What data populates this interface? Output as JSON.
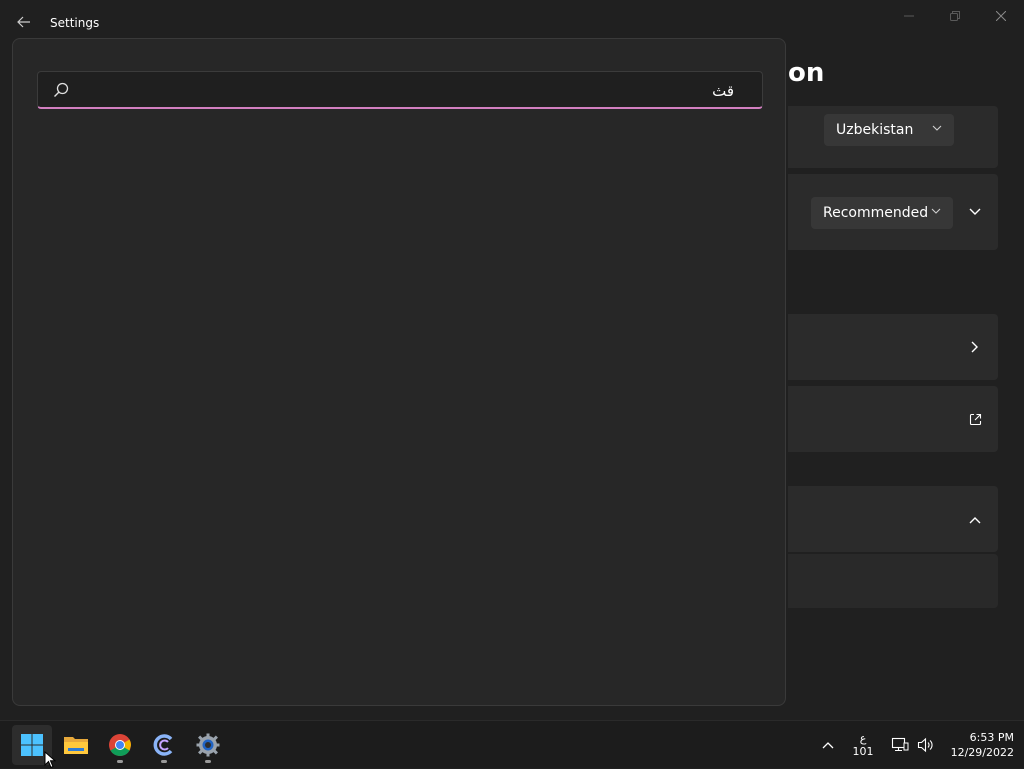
{
  "window": {
    "title": "Settings",
    "page_title_partial": "on"
  },
  "right_panel": {
    "country_dropdown": {
      "value": "Uzbekistan"
    },
    "format_dropdown": {
      "value": "Recommended"
    }
  },
  "search": {
    "value": "قث",
    "placeholder": ""
  },
  "taskbar": {
    "apps": [
      "Start",
      "File Explorer",
      "Google Chrome",
      "Cortana",
      "Settings"
    ],
    "language_line1": "ع",
    "language_line2": "101",
    "time": "6:53 PM",
    "date": "12/29/2022"
  },
  "colors": {
    "accent": "#d27fc0",
    "window_bg": "#202020",
    "card_bg": "#2b2b2b",
    "panel_bg": "#272727"
  }
}
